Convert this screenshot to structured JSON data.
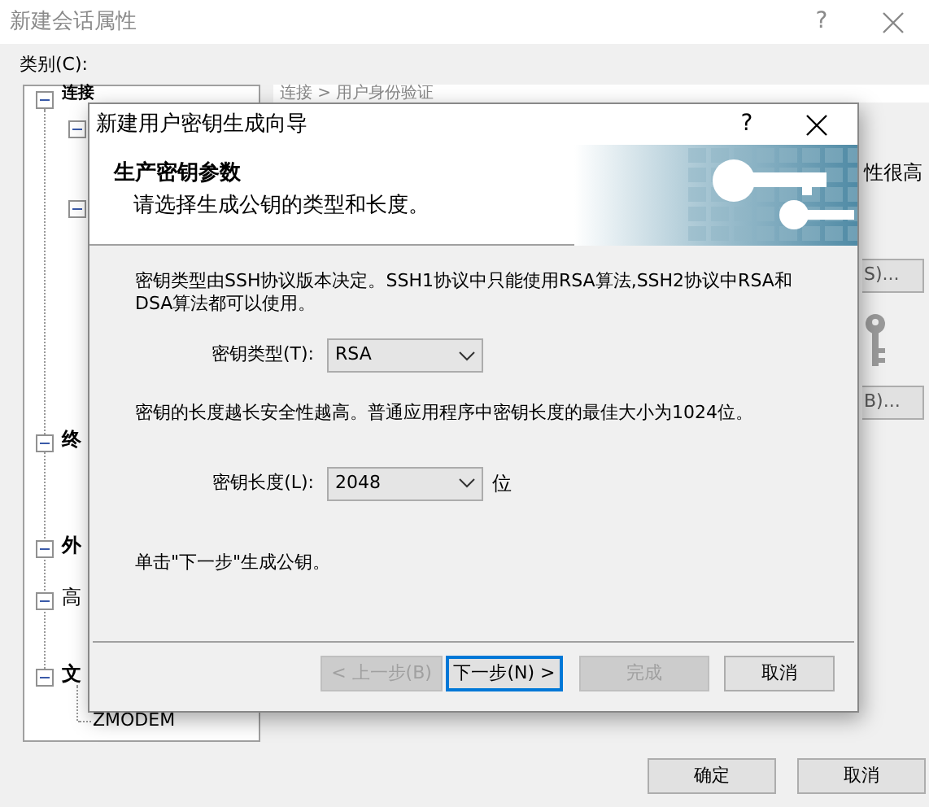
{
  "background_window": {
    "title": "新建会话属性",
    "help": "?",
    "category_label": "类别(C):",
    "tree": [
      {
        "label": "连接",
        "bold": true,
        "expanded": true,
        "children": [
          {
            "expanded": true
          },
          {
            "expanded": true
          }
        ]
      },
      {
        "label": "终",
        "bold": true,
        "expanded": true
      },
      {
        "label": "外",
        "bold": true,
        "expanded": true
      },
      {
        "label": "高",
        "bold": false,
        "expanded": true
      },
      {
        "label": "文",
        "bold": true,
        "expanded": true,
        "children": [
          {
            "label": "ZMODEM"
          }
        ]
      }
    ],
    "panel_title": "连接 > 用户身份验证",
    "panel_text": "性很高",
    "side_buttons": [
      "S)...",
      "B)..."
    ],
    "buttons": [
      "确定",
      "取消"
    ]
  },
  "wizard": {
    "title": "新建用户密钥生成向导",
    "help": "?",
    "heading": "生产密钥参数",
    "subheading": "请选择生成公钥的类型和长度。",
    "intro": "密钥类型由SSH协议版本决定。SSH1协议中只能使用RSA算法,SSH2协议中RSA和DSA算法都可以使用。",
    "key_type": {
      "label": "密钥类型(T):",
      "value": "RSA"
    },
    "length_note": "密钥的长度越长安全性越高。普通应用程序中密钥长度的最佳大小为1024位。",
    "key_length": {
      "label": "密钥长度(L):",
      "value": "2048",
      "unit": "位"
    },
    "hint": "单击\"下一步\"生成公钥。",
    "buttons": [
      {
        "label": "< 上一步(B)",
        "disabled": true,
        "focused": false
      },
      {
        "label": "下一步(N) >",
        "disabled": false,
        "focused": true
      },
      {
        "label": "完成",
        "disabled": true,
        "focused": false
      },
      {
        "label": "取消",
        "disabled": false,
        "focused": false
      }
    ]
  }
}
